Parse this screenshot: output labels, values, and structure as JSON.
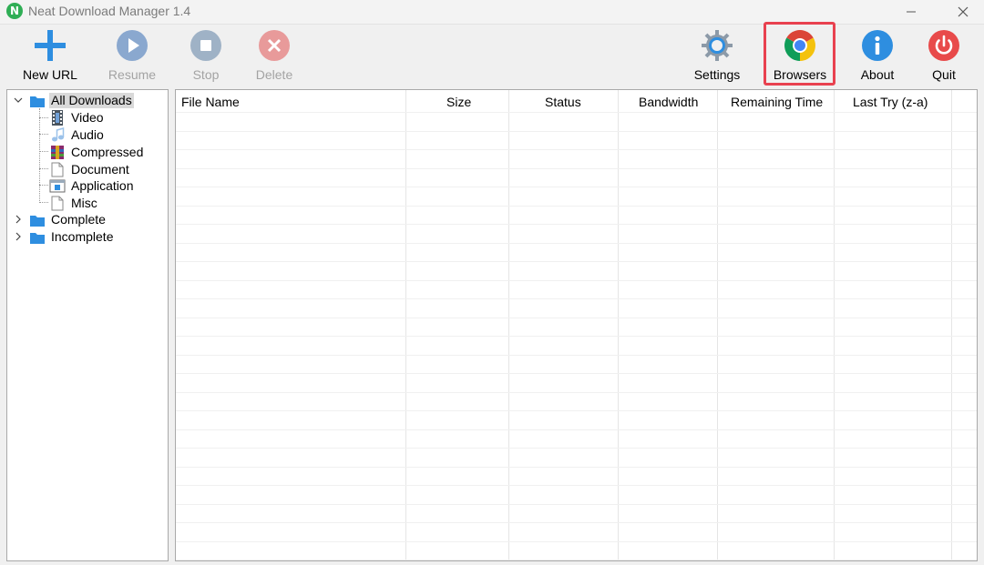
{
  "window": {
    "title": "Neat Download Manager 1.4",
    "app_icon_letter": "N"
  },
  "toolbar": {
    "new_url": "New URL",
    "resume": "Resume",
    "stop": "Stop",
    "delete": "Delete",
    "settings": "Settings",
    "browsers": "Browsers",
    "about": "About",
    "quit": "Quit"
  },
  "tree": {
    "all_downloads": "All Downloads",
    "children": {
      "video": "Video",
      "audio": "Audio",
      "compressed": "Compressed",
      "document": "Document",
      "application": "Application",
      "misc": "Misc"
    },
    "complete": "Complete",
    "incomplete": "Incomplete"
  },
  "list": {
    "columns": [
      "File Name",
      "Size",
      "Status",
      "Bandwidth",
      "Remaining Time",
      "Last Try (z-a)"
    ]
  },
  "colors": {
    "accent_blue": "#2e8ee0",
    "disabled_gray": "#a3a3a3",
    "highlight_red": "#e8414f",
    "quit_red": "#e84a4a"
  }
}
